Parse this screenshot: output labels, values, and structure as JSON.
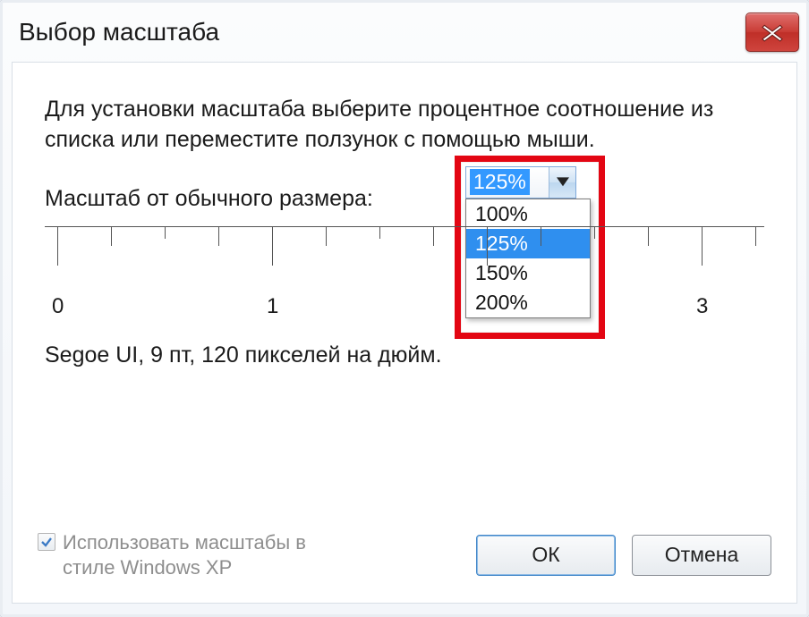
{
  "window": {
    "title": "Выбор масштаба"
  },
  "instruction": "Для установки масштаба выберите процентное соотношение из списка или переместите ползунок с помощью мыши.",
  "scale_label": "Масштаб от обычного размера:",
  "combo": {
    "selected": "125%",
    "options": [
      "100%",
      "125%",
      "150%",
      "200%"
    ]
  },
  "ruler_labels": {
    "l0": "0",
    "l1": "1",
    "l2": "",
    "l3": "3"
  },
  "dpi_text": "Segoe UI, 9 пт, 120 пикселей на дюйм.",
  "checkbox": {
    "label": "Использовать масштабы в стиле Windows XP",
    "checked": true
  },
  "buttons": {
    "ok": "ОК",
    "cancel": "Отмена"
  }
}
